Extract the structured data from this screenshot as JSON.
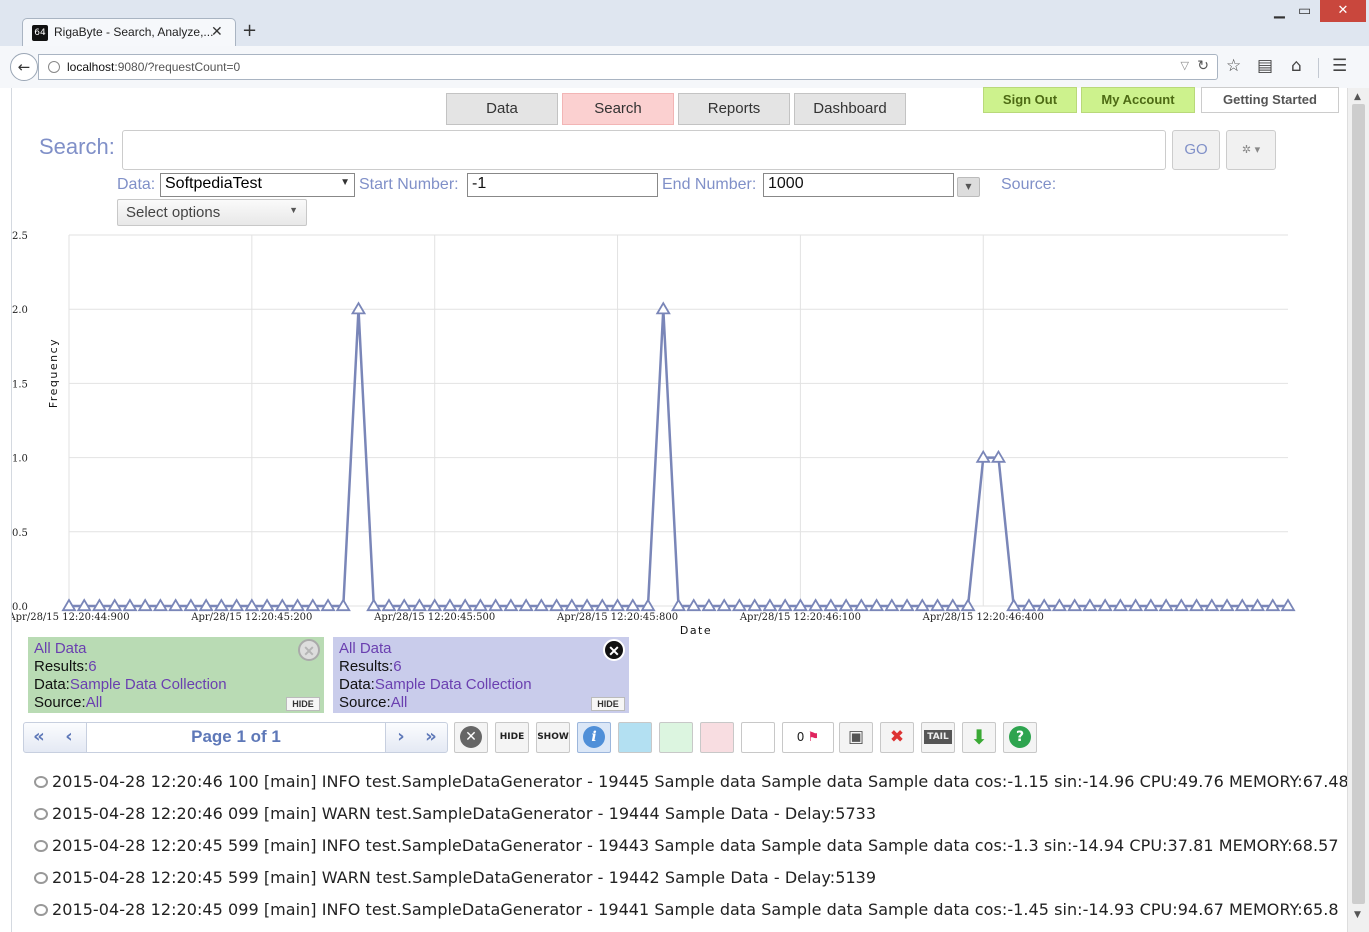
{
  "browser": {
    "tab_title": "RigaByte - Search, Analyze,...",
    "favicon": "64",
    "tab_close": "✕",
    "new_tab": "+",
    "url_host": "localhost",
    "url_rest": ":9080/?requestCount=0"
  },
  "nav": {
    "data": "Data",
    "search": "Search",
    "reports": "Reports",
    "dashboard": "Dashboard",
    "sign_out": "Sign Out",
    "my_account": "My Account",
    "getting_started": "Getting Started"
  },
  "search": {
    "label": "Search:",
    "query": "",
    "go": "GO"
  },
  "filters": {
    "data_label": "Data:",
    "data_value": "SoftpediaTest",
    "start_label": "Start Number:",
    "start_value": "-1",
    "end_label": "End Number:",
    "end_value": "1000",
    "source_label": "Source:",
    "select_options": "Select options"
  },
  "chart_data": {
    "type": "line",
    "xlabel": "Date",
    "ylabel": "Frequency",
    "ylim": [
      0,
      2.5
    ],
    "yticks": [
      "0.0",
      "0.5",
      "1.0",
      "1.5",
      "2.0",
      "2.5"
    ],
    "xticks": [
      "Apr/28/15 12:20:44:900",
      "Apr/28/15 12:20:45:200",
      "Apr/28/15 12:20:45:500",
      "Apr/28/15 12:20:45:800",
      "Apr/28/15 12:20:46:100",
      "Apr/28/15 12:20:46:400"
    ],
    "x_start_ms": 44900,
    "x_step_ms": 25,
    "color": "#7a86b8",
    "values": [
      0,
      0,
      0,
      0,
      0,
      0,
      0,
      0,
      0,
      0,
      0,
      0,
      0,
      0,
      0,
      0,
      0,
      0,
      0,
      2,
      0,
      0,
      0,
      0,
      0,
      0,
      0,
      0,
      0,
      0,
      0,
      0,
      0,
      0,
      0,
      0,
      0,
      0,
      0,
      2,
      0,
      0,
      0,
      0,
      0,
      0,
      0,
      0,
      0,
      0,
      0,
      0,
      0,
      0,
      0,
      0,
      0,
      0,
      0,
      0,
      1,
      1,
      0,
      0,
      0,
      0,
      0,
      0,
      0,
      0,
      0,
      0,
      0,
      0,
      0,
      0,
      0,
      0,
      0,
      0,
      0
    ]
  },
  "cards": [
    {
      "title": "All Data",
      "results_label": "Results:",
      "results": "6",
      "data_label": "Data:",
      "data": "Sample Data Collection",
      "source_label": "Source:",
      "source": "All",
      "hide": "HIDE",
      "bg": "#b9dbb4"
    },
    {
      "title": "All Data",
      "results_label": "Results:",
      "results": "6",
      "data_label": "Data:",
      "data": "Sample Data Collection",
      "source_label": "Source:",
      "source": "All",
      "hide": "HIDE",
      "bg": "#c9cceb"
    }
  ],
  "pager": {
    "first": "«",
    "prev": "‹",
    "label": "Page 1 of 1",
    "next": "›",
    "last": "»"
  },
  "toolbar": {
    "hide": "HIDE",
    "show": "SHOW",
    "flag_count": "0",
    "tail": "TAIL"
  },
  "log_lines": [
    "2015-04-28 12:20:46 100 [main] INFO test.SampleDataGenerator - 19445 Sample data Sample data Sample data cos:-1.15 sin:-14.96 CPU:49.76 MEMORY:67.48",
    "2015-04-28 12:20:46 099 [main] WARN test.SampleDataGenerator - 19444 Sample Data - Delay:5733",
    "2015-04-28 12:20:45 599 [main] INFO test.SampleDataGenerator - 19443 Sample data Sample data Sample data cos:-1.3 sin:-14.94 CPU:37.81 MEMORY:68.57",
    "2015-04-28 12:20:45 599 [main] WARN test.SampleDataGenerator - 19442 Sample Data - Delay:5139",
    "2015-04-28 12:20:45 099 [main] INFO test.SampleDataGenerator - 19441 Sample data Sample data Sample data cos:-1.45 sin:-14.93 CPU:94.67 MEMORY:65.8"
  ]
}
